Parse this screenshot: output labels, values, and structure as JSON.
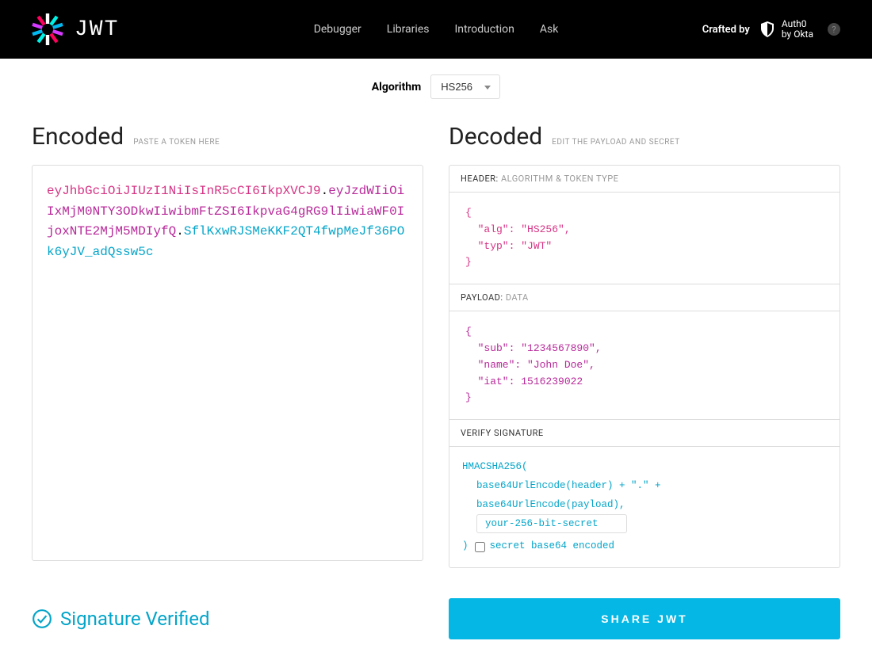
{
  "nav": {
    "debugger": "Debugger",
    "libraries": "Libraries",
    "introduction": "Introduction",
    "ask": "Ask"
  },
  "crafted_by": "Crafted by",
  "auth0": {
    "line1": "Auth0",
    "line2": "by Okta"
  },
  "algo": {
    "label": "Algorithm",
    "selected": "HS256"
  },
  "encoded": {
    "title": "Encoded",
    "sub": "PASTE A TOKEN HERE",
    "token": {
      "header": "eyJhbGciOiJIUzI1NiIsInR5cCI6IkpXVCJ9",
      "payload": "eyJzdWIiOiIxMjM0NTY3ODkwIiwibmFtZSI6IkpvaG4gRG9lIiwiaWF0IjoxNTE2MjM5MDIyfQ",
      "signature": "SflKxwRJSMeKKF2QT4fwpMeJf36POk6yJV_adQssw5c"
    }
  },
  "decoded": {
    "title": "Decoded",
    "sub": "EDIT THE PAYLOAD AND SECRET",
    "header_section": {
      "label": "HEADER:",
      "sub": "ALGORITHM & TOKEN TYPE"
    },
    "header_json": {
      "alg": "HS256",
      "typ": "JWT"
    },
    "payload_section": {
      "label": "PAYLOAD:",
      "sub": "DATA"
    },
    "payload_json": {
      "sub": "1234567890",
      "name": "John Doe",
      "iat": 1516239022
    },
    "sig_section": {
      "label": "VERIFY SIGNATURE"
    },
    "sig": {
      "fn": "HMACSHA256(",
      "l1": "base64UrlEncode(header) + \".\" +",
      "l2": "base64UrlEncode(payload),",
      "secret": "your-256-bit-secret",
      "close": ")",
      "b64_label": "secret base64 encoded"
    }
  },
  "verified": "Signature Verified",
  "share": "SHARE JWT"
}
